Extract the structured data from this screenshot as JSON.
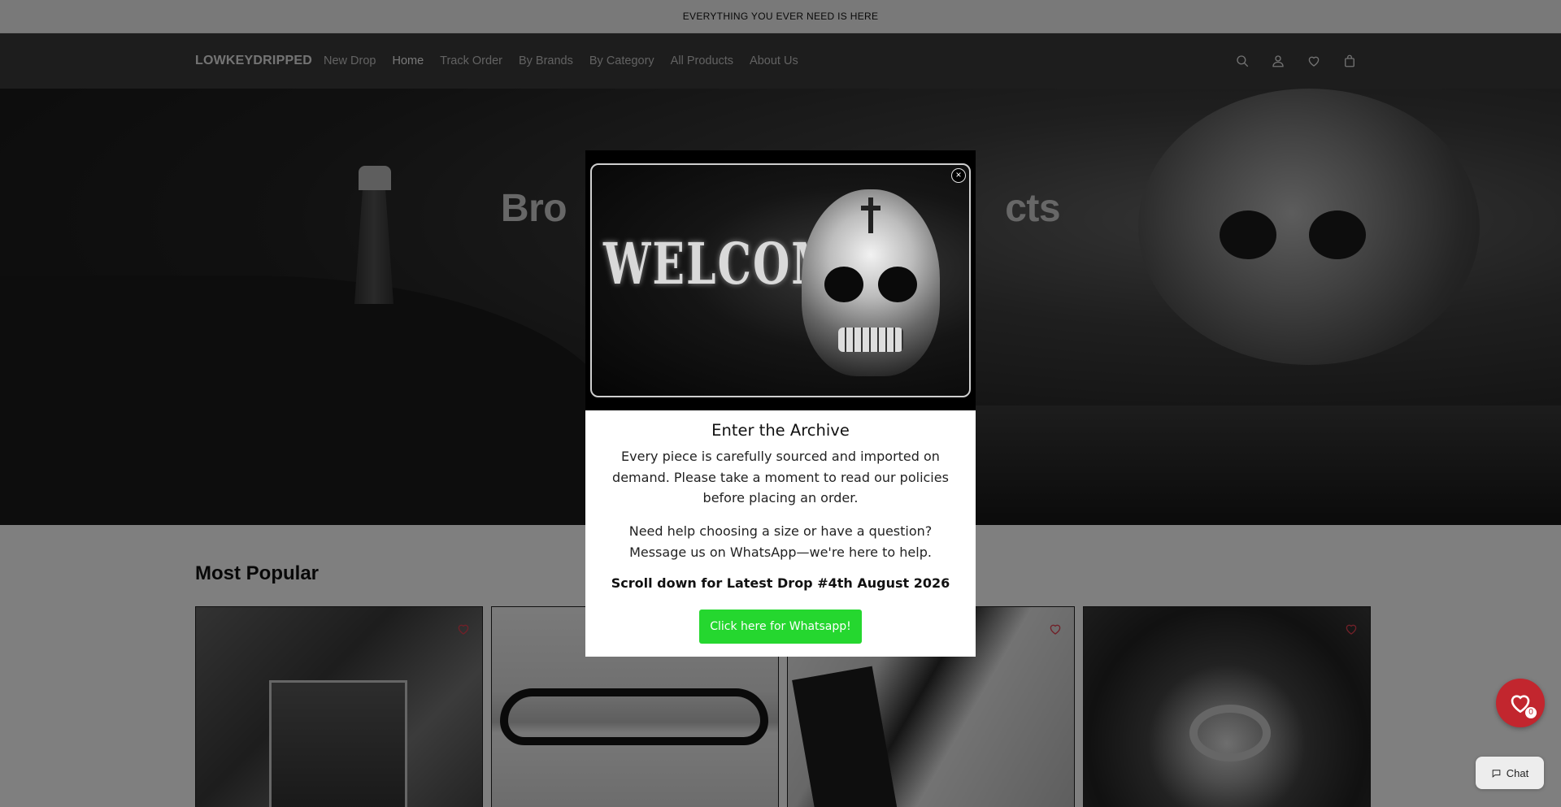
{
  "announcement": "EVERYTHING YOU EVER NEED IS HERE",
  "header": {
    "logo": "LOWKEYDRIPPED",
    "nav": [
      {
        "label": "New Drop"
      },
      {
        "label": "Home"
      },
      {
        "label": "Track Order"
      },
      {
        "label": "By Brands"
      },
      {
        "label": "By Category"
      },
      {
        "label": "All Products"
      },
      {
        "label": "About Us"
      }
    ],
    "active_nav": "Home",
    "icons": [
      "search-icon",
      "account-icon",
      "wishlist-icon",
      "cart-icon"
    ]
  },
  "hero": {
    "title_visible": "Bro                                          cts"
  },
  "main": {
    "section_title": "Most Popular"
  },
  "modal": {
    "banner_text": "WELCOME",
    "close_label": "×",
    "title": "Enter the Archive",
    "text1": "Every piece is carefully sourced and imported on demand. Please take a moment to read our policies before placing an order.",
    "text2": "Need help choosing a size or have a question? Message us on WhatsApp—we're here to help.",
    "drop_notice": "Scroll down for Latest Drop #4th August 2026",
    "whatsapp_button": "Click here for Whatsapp!"
  },
  "wishlist_fab": {
    "count": "0"
  },
  "chat": {
    "label": "Chat"
  },
  "colors": {
    "header_bg": "#3a3a3a",
    "whatsapp_green": "#25d72f",
    "wishlist_red": "#c2262e"
  }
}
